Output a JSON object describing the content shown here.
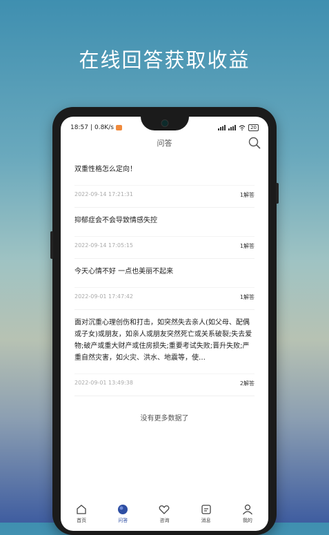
{
  "headline": "在线回答获取收益",
  "status": {
    "time": "18:57",
    "speed": "0.8K/s",
    "battery": "20"
  },
  "header": {
    "title": "问答"
  },
  "questions": [
    {
      "title": "双重性格怎么定向！",
      "date": "2022-09-14 17:21:31",
      "answers": "1解答"
    },
    {
      "title": "抑郁症会不会导致情感失控",
      "date": "2022-09-14 17:05:15",
      "answers": "1解答"
    },
    {
      "title": "今天心情不好 一点也美丽不起来",
      "date": "2022-09-01 17:47:42",
      "answers": "1解答"
    },
    {
      "title": "面对沉重心理创伤和打击，如突然失去亲人(如父母、配偶或子女)或朋友，如亲人或朋友突然死亡或关系破裂;失去爱物;破产或重大财产或住房损失;重要考试失败;晋升失败;严重自然灾害，如火灾、洪水、地震等，使…",
      "date": "2022-09-01 13:49:38",
      "answers": "2解答"
    }
  ],
  "no_more": "没有更多数据了",
  "tabs": [
    {
      "label": "首页",
      "icon": "home-icon"
    },
    {
      "label": "问答",
      "icon": "qa-icon"
    },
    {
      "label": "咨询",
      "icon": "heart-icon"
    },
    {
      "label": "消息",
      "icon": "message-icon"
    },
    {
      "label": "我的",
      "icon": "user-icon"
    }
  ],
  "colors": {
    "accent": "#2d4ea3",
    "battery_badge": "#f08a3c"
  }
}
